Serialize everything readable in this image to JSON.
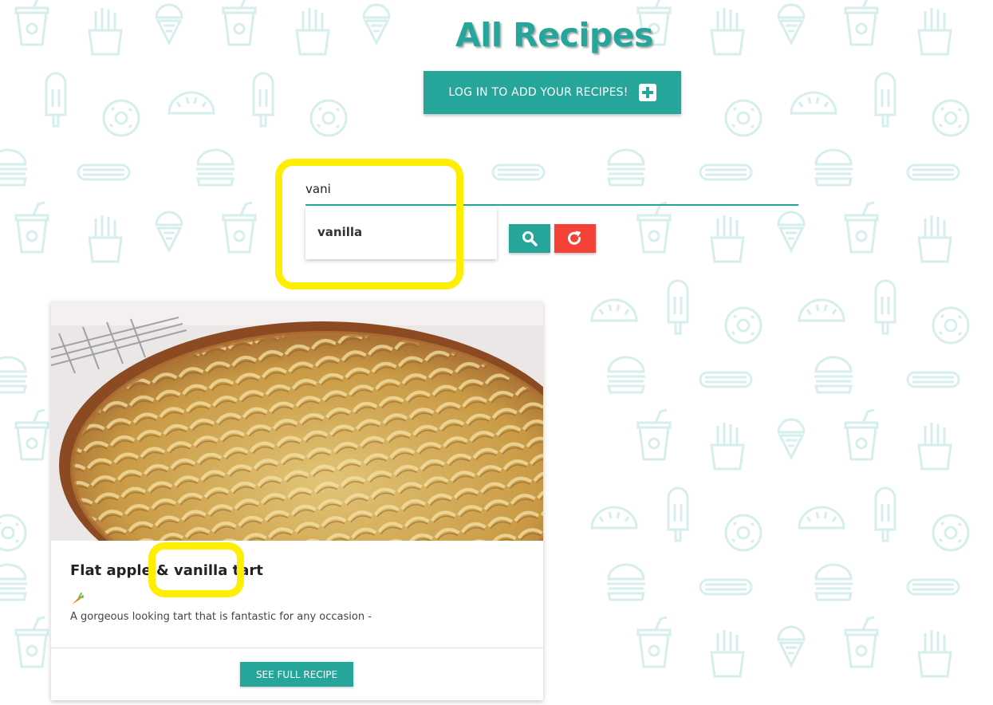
{
  "page": {
    "title": "All Recipes"
  },
  "login_button": {
    "label": "LOG IN TO ADD YOUR RECIPES!"
  },
  "search": {
    "value": "vani",
    "suggestions": [
      "vanilla"
    ]
  },
  "recipe_card": {
    "title": "Flat apple & vanilla tart",
    "description": "A gorgeous looking tart that is fantastic for any occasion -",
    "button_label": "SEE FULL RECIPE"
  },
  "colors": {
    "accent": "#26a69a",
    "reset": "#f44336",
    "highlight": "#ffee00",
    "pattern": "#d6efec"
  },
  "icons": {
    "login": "plus-box-icon",
    "search": "search-icon",
    "reset": "redo-icon",
    "category": "carrot-icon"
  }
}
